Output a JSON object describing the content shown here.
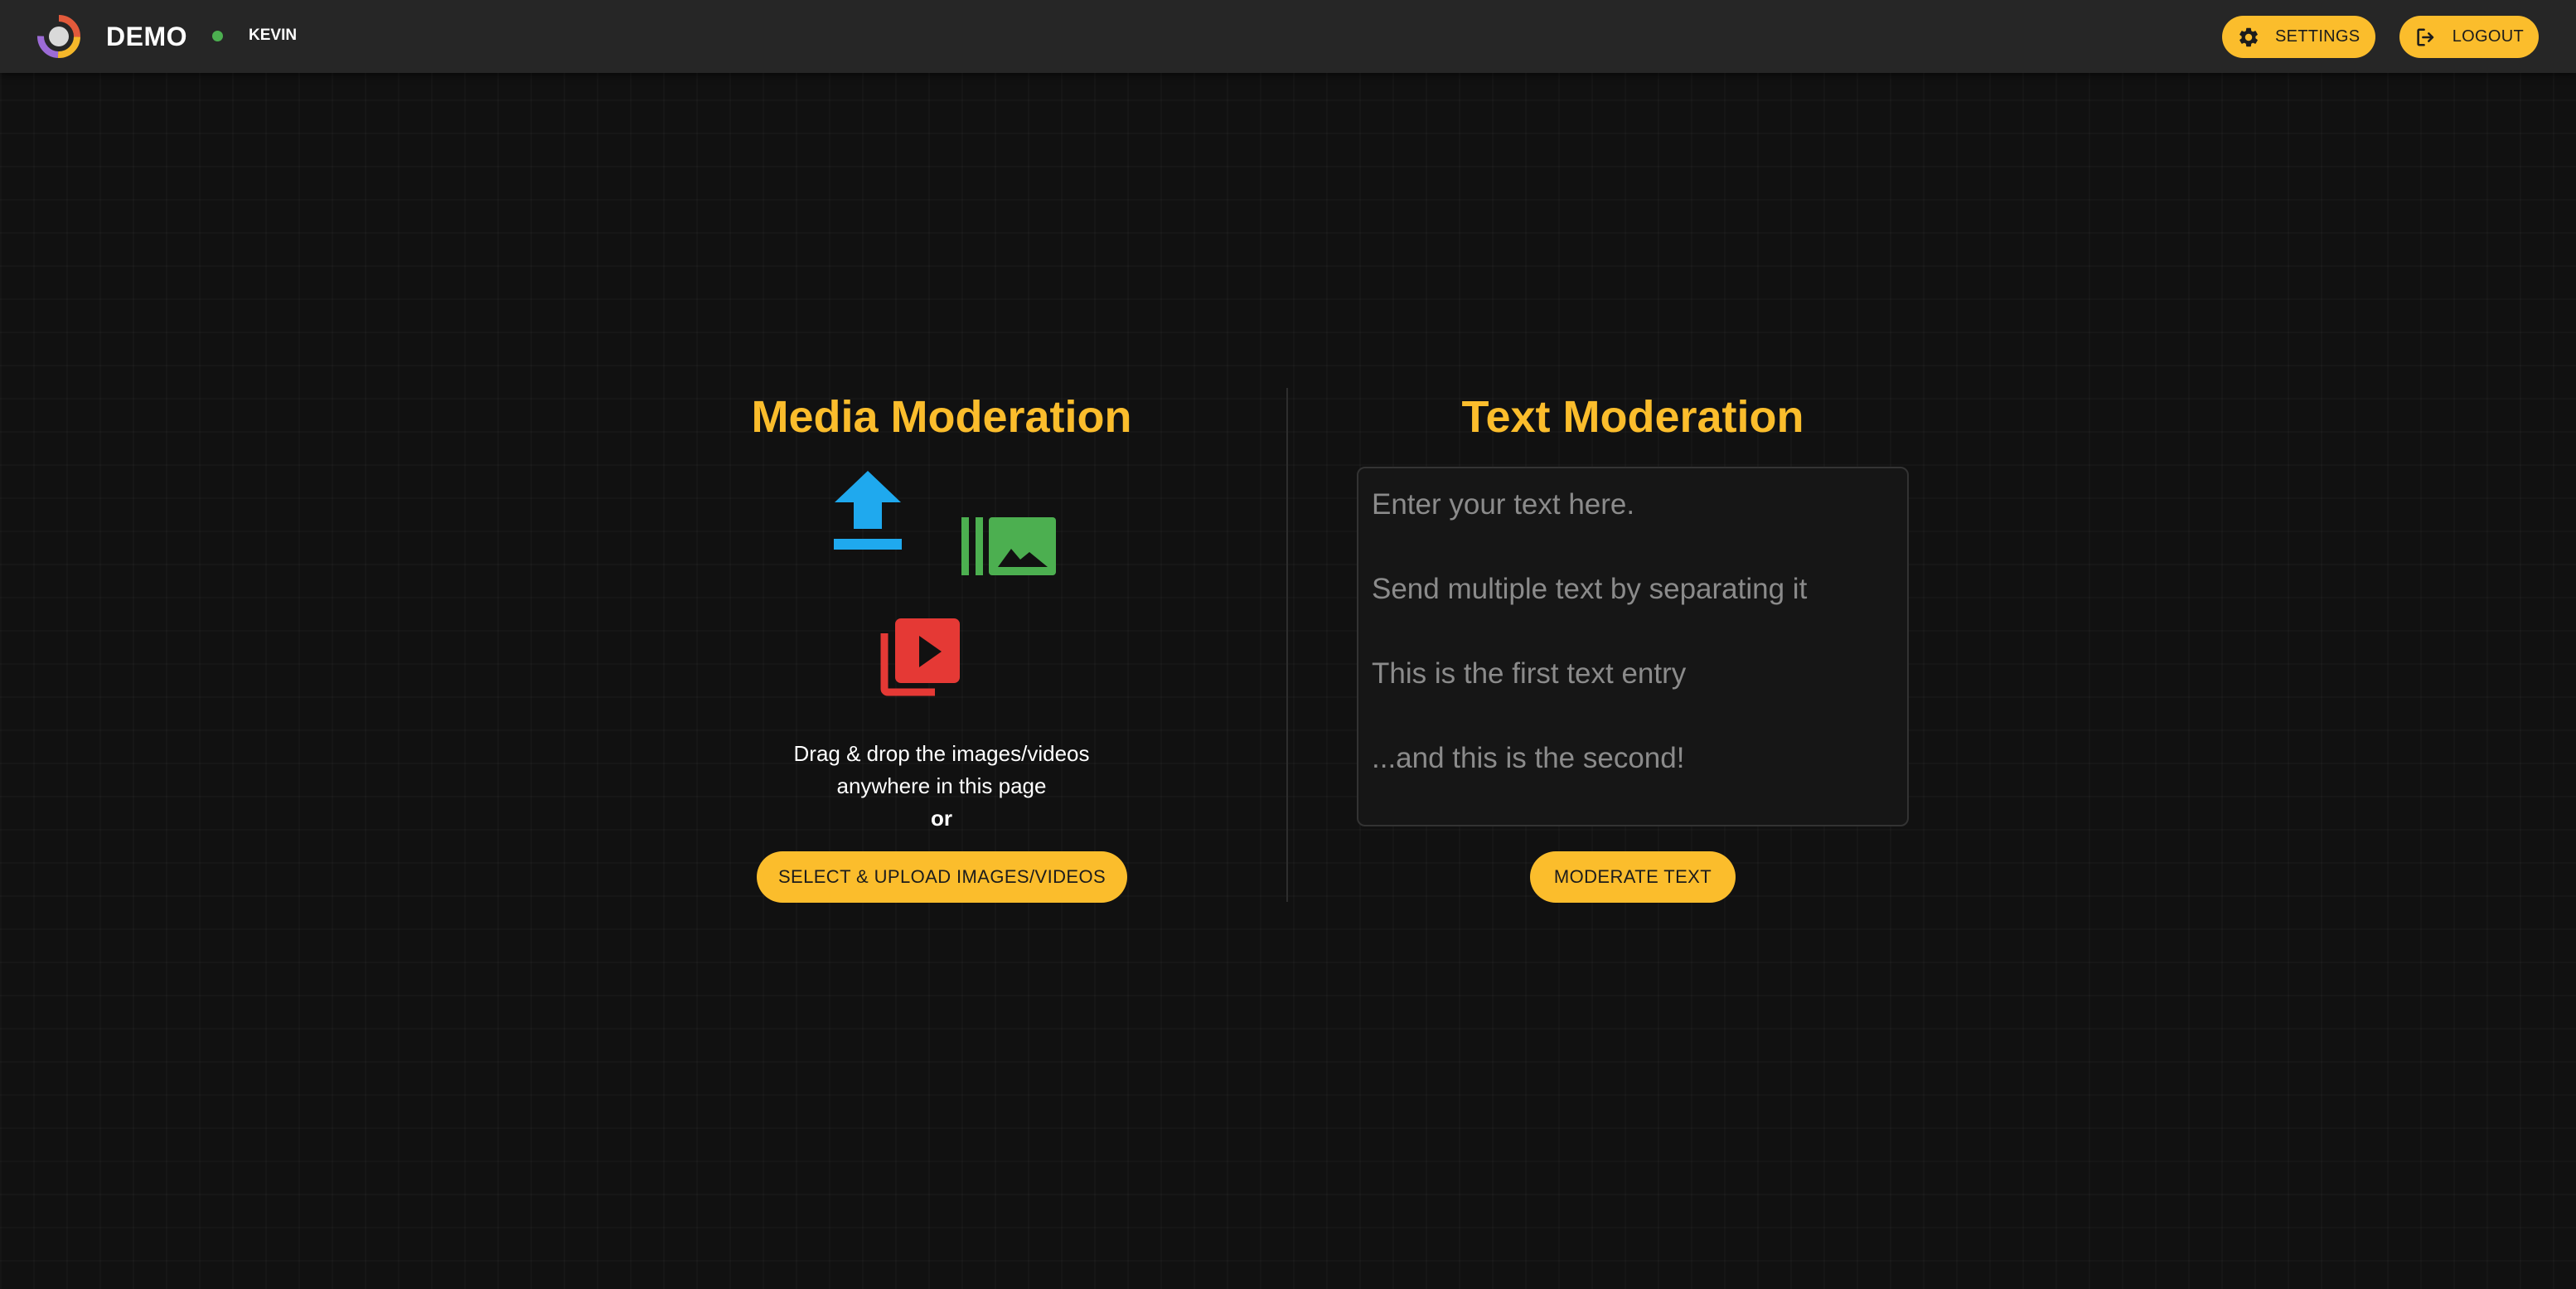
{
  "header": {
    "app_name": "DEMO",
    "username": "KEVIN",
    "status_color": "#4caf50",
    "settings_label": "SETTINGS",
    "logout_label": "LOGOUT",
    "settings_icon": "gear-icon",
    "logout_icon": "logout-icon"
  },
  "media": {
    "title": "Media Moderation",
    "drop_line1": "Drag & drop the images/videos",
    "drop_line2": "anywhere in this page",
    "drop_or": "or",
    "upload_button_label": "SELECT & UPLOAD IMAGES/VIDEOS",
    "icons": {
      "upload": "upload-icon",
      "images": "photo-library-icon",
      "video": "video-library-icon"
    }
  },
  "text": {
    "title": "Text Moderation",
    "placeholder": "Enter your text here.\n\nSend multiple text by separating it\n\nThis is the first text entry\n\n...and this is the second!",
    "value": "",
    "moderate_button_label": "MODERATE TEXT"
  },
  "colors": {
    "accent": "#fbbd2c",
    "header_bg": "#262626",
    "page_bg": "#111111",
    "upload_icon": "#1fa9ee",
    "images_icon": "#4caf50",
    "video_icon": "#e53935"
  }
}
